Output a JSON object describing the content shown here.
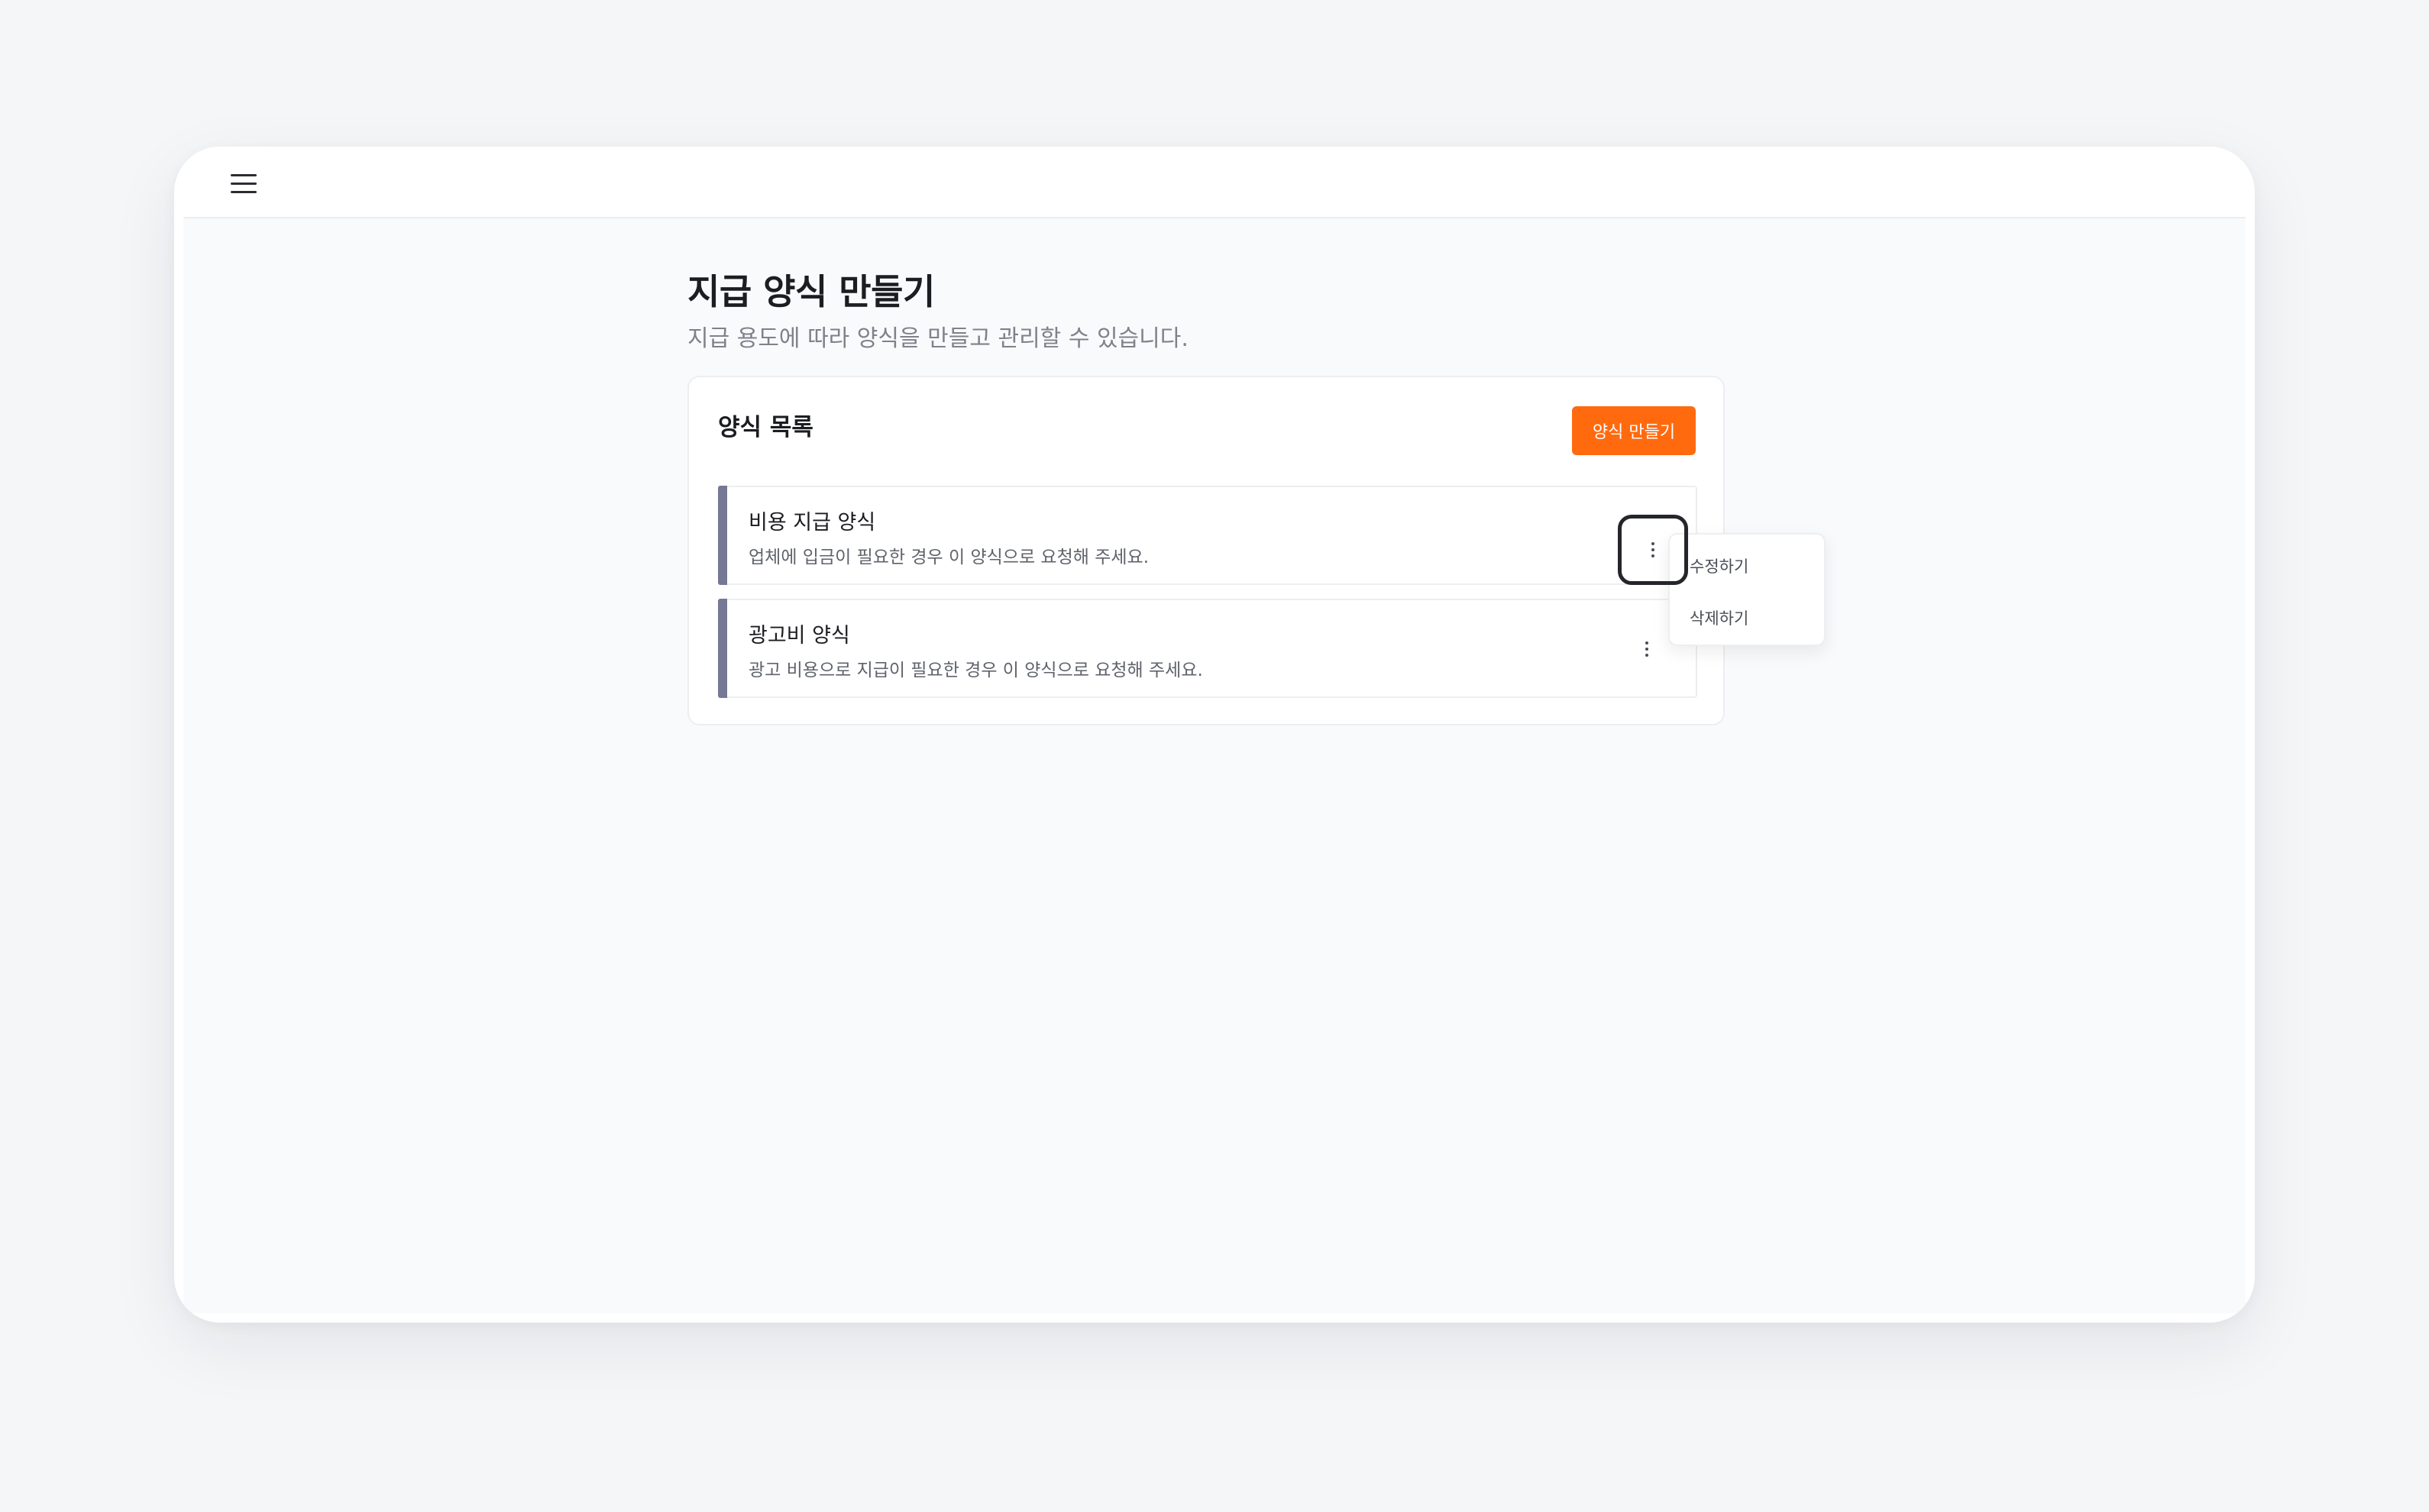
{
  "header": {
    "menu_icon": "hamburger-menu-icon"
  },
  "page": {
    "title": "지급 양식 만들기",
    "subtitle": "지급 용도에 따라 양식을 만들고 관리할 수 있습니다."
  },
  "form_list": {
    "title": "양식 목록",
    "create_button_label": "양식 만들기",
    "accent_color": "#767995",
    "button_color": "#ff6a0f",
    "items": [
      {
        "title": "비용 지급 양식",
        "description": "업체에 입금이 필요한 경우 이 양식으로 요청해 주세요.",
        "menu_icon": "more-vertical-icon"
      },
      {
        "title": "광고비 양식",
        "description": "광고 비용으로 지급이 필요한 경우 이 양식으로 요청해 주세요.",
        "menu_icon": "more-vertical-icon"
      }
    ]
  },
  "context_menu": {
    "items": [
      {
        "label": "수정하기"
      },
      {
        "label": "삭제하기"
      }
    ]
  }
}
